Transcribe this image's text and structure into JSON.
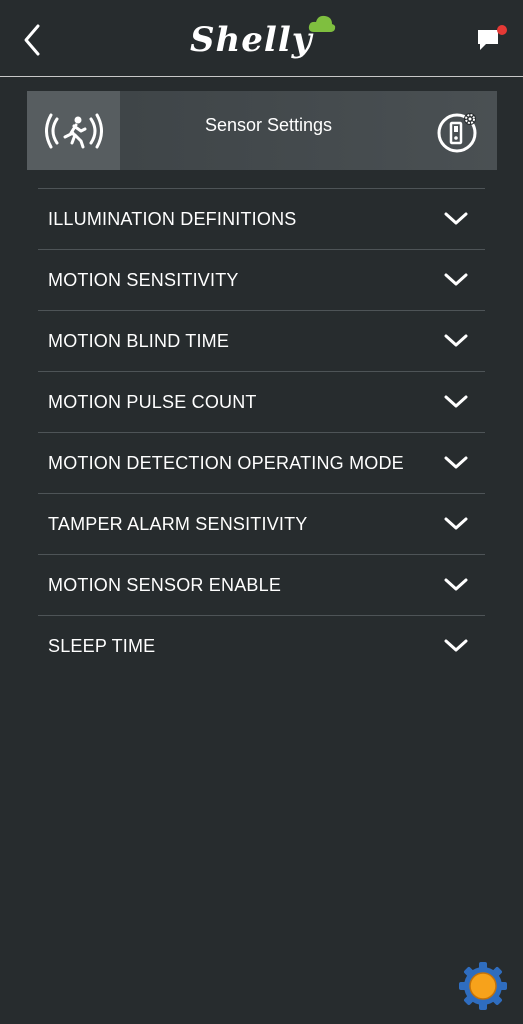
{
  "header": {
    "logo_text": "Shelly",
    "back_icon": "chevron-left-icon",
    "chat_icon": "chat-notification-icon",
    "accent": "#7fbf3f",
    "notification_color": "#e53935"
  },
  "banner": {
    "title": "Sensor Settings",
    "left_icon": "motion-sensor-icon",
    "right_icon": "device-settings-icon"
  },
  "settings": [
    {
      "label": "ILLUMINATION DEFINITIONS"
    },
    {
      "label": "MOTION SENSITIVITY"
    },
    {
      "label": "MOTION BLIND TIME"
    },
    {
      "label": "MOTION PULSE COUNT"
    },
    {
      "label": "MOTION DETECTION OPERATING MODE"
    },
    {
      "label": "TAMPER ALARM SENSITIVITY"
    },
    {
      "label": "MOTION SENSOR ENABLE"
    },
    {
      "label": "SLEEP TIME"
    }
  ],
  "fab": {
    "icon": "gear-icon",
    "colors": {
      "gear": "#2f6dbf",
      "center": "#f7a21b"
    }
  }
}
